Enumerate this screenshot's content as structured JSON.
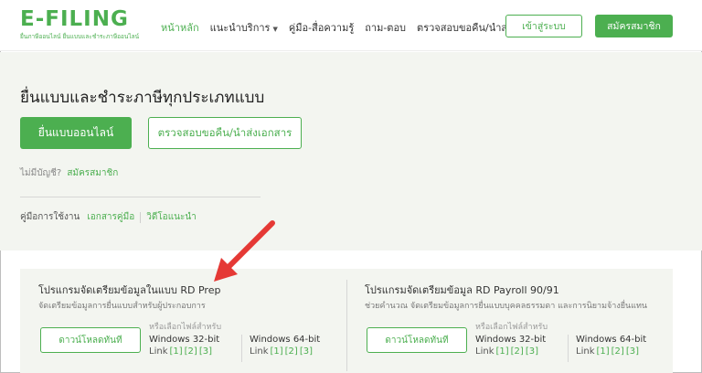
{
  "header": {
    "logo_text": "E-FILING",
    "logo_sub": "ยื่นภาษีออนไลน์ ยื่นแบบและชำระภาษีออนไลน์",
    "nav": [
      {
        "label": "หน้าหลัก",
        "active": true
      },
      {
        "label": "แนะนำบริการ",
        "dropdown": true
      },
      {
        "label": "คู่มือ-สื่อความรู้"
      },
      {
        "label": "ถาม-ตอบ"
      },
      {
        "label": "ตรวจสอบขอคืน/นำส่งเอกสาร"
      }
    ],
    "login_label": "เข้าสู่ระบบ",
    "register_label": "สมัครสมาชิก"
  },
  "hero": {
    "title": "ยื่นแบบและชำระภาษีทุกประเภทแบบ",
    "file_online_label": "ยื่นแบบออนไลน์",
    "check_refund_label": "ตรวจสอบขอคืน/นำส่งเอกสาร",
    "no_account_text": "ไม่มีบัญชี?",
    "register_link": "สมัครสมาชิก",
    "manual_text": "คู่มือการใช้งาน",
    "manual_doc_link": "เอกสารคู่มือ",
    "manual_video_link": "วิดีโอแนะนำ"
  },
  "programs": [
    {
      "title": "โปรแกรมจัดเตรียมข้อมูลในแบบ RD Prep",
      "desc": "จัดเตรียมข้อมูลการยื่นแบบสำหรับผู้ประกอบการ",
      "download_label": "ดาวน์โหลดทันที",
      "choose_text": "หรือเลือกไฟล์สำหรับ",
      "os32": "Windows 32-bit",
      "os64": "Windows 64-bit",
      "link_prefix": "Link",
      "links": [
        "[1]",
        "[2]",
        "[3]"
      ]
    },
    {
      "title": "โปรแกรมจัดเตรียมข้อมูล RD Payroll 90/91",
      "desc": "ช่วยคำนวณ จัดเตรียมข้อมูลการยื่นแบบบุคคลธรรมดา และการนิยามจ้างยื่นแทน",
      "download_label": "ดาวน์โหลดทันที",
      "choose_text": "หรือเลือกไฟล์สำหรับ",
      "os32": "Windows 32-bit",
      "os64": "Windows 64-bit",
      "link_prefix": "Link",
      "links": [
        "[1]",
        "[2]",
        "[3]"
      ]
    }
  ],
  "colors": {
    "accent": "#4caf50",
    "arrow": "#e53935",
    "hero_bg": "#f3f5f0"
  }
}
